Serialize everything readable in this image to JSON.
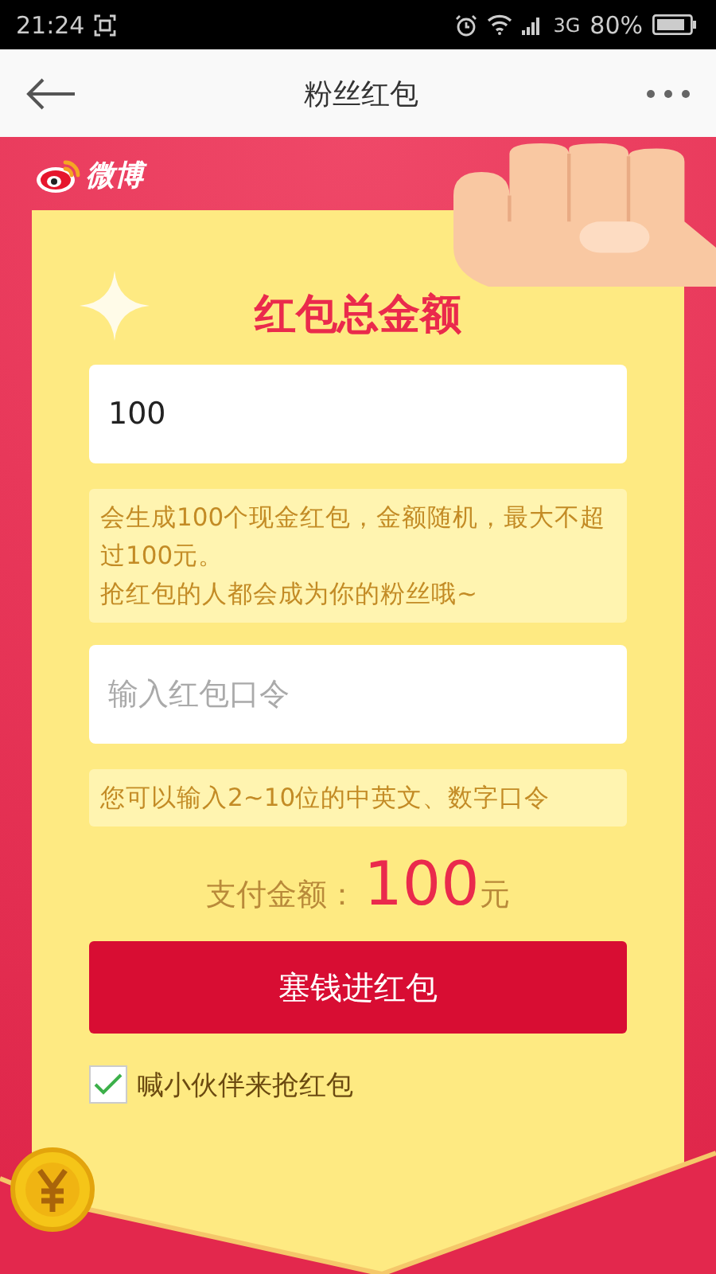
{
  "status_bar": {
    "time": "21:24",
    "network": "3G",
    "battery": "80%"
  },
  "header": {
    "title": "粉丝红包"
  },
  "brand": {
    "name": "微博"
  },
  "form": {
    "heading": "红包总金额",
    "amount": {
      "value": "100"
    },
    "amount_tip": [
      "会生成100个现金红包，金额随机，最大不超过100元。",
      "抢红包的人都会成为你的粉丝哦~"
    ],
    "password": {
      "placeholder": "输入红包口令"
    },
    "password_tip": "您可以输入2~10位的中英文、数字口令",
    "payment": {
      "label": "支付金额：",
      "amount": "100",
      "unit": "元"
    },
    "submit": "塞钱进红包",
    "share": {
      "label": "喊小伙伴来抢红包",
      "checked": true
    }
  }
}
